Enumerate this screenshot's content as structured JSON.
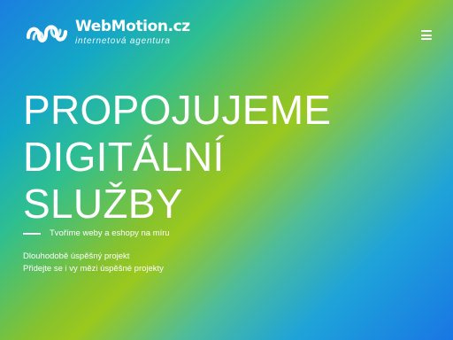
{
  "header": {
    "logo_name": "WebMotion.cz",
    "logo_tagline": "internetová agentura",
    "menu_icon": "hamburger-menu-icon"
  },
  "hero": {
    "title_lines": [
      "PROPOJUJEME",
      "DIGITÁLNÍ",
      "SLUŽBY"
    ],
    "subtitle": "Tvoříme weby a eshopy na míru",
    "links": [
      "Dlouhodobě úspěšný projekt",
      "Přidejte se i vy mězi úspěšné projekty"
    ]
  },
  "colors": {
    "gradient_blue": "#1a7fe0",
    "gradient_green": "#9ac81e",
    "text": "#ffffff"
  }
}
